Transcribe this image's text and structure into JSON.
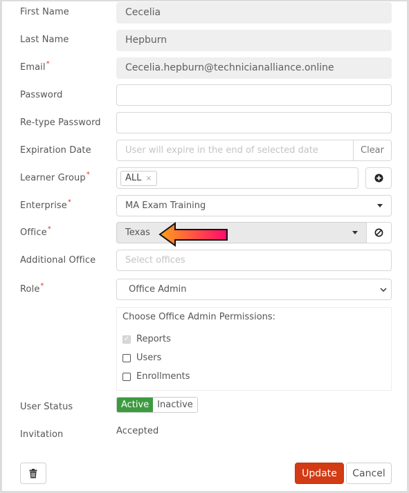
{
  "fields": {
    "first_name": {
      "label": "First Name",
      "value": "Cecelia"
    },
    "last_name": {
      "label": "Last Name",
      "value": "Hepburn"
    },
    "email": {
      "label": "Email",
      "required_mark": "*",
      "value": "Cecelia.hepburn@technicianalliance.online"
    },
    "password": {
      "label": "Password",
      "value": ""
    },
    "retype_password": {
      "label": "Re-type Password",
      "value": ""
    },
    "expiration_date": {
      "label": "Expiration Date",
      "placeholder": "User will expire in the end of selected date",
      "clear_label": "Clear"
    },
    "learner_group": {
      "label": "Learner Group",
      "required_mark": "*",
      "tags": [
        "ALL"
      ],
      "tag_remove": "×",
      "add_icon": "plus-circle-icon"
    },
    "enterprise": {
      "label": "Enterprise",
      "required_mark": "*",
      "value": "MA Exam Training"
    },
    "office": {
      "label": "Office",
      "required_mark": "*",
      "value": "Texas",
      "clear_icon": "ban-icon"
    },
    "additional_office": {
      "label": "Additional Office",
      "placeholder": "Select offices"
    },
    "role": {
      "label": "Role",
      "required_mark": "*",
      "value": "Office Admin"
    }
  },
  "permissions": {
    "title": "Choose Office Admin Permissions:",
    "items": [
      {
        "label": "Reports",
        "checked": true,
        "disabled": true
      },
      {
        "label": "Users",
        "checked": false,
        "disabled": false
      },
      {
        "label": "Enrollments",
        "checked": false,
        "disabled": false
      }
    ]
  },
  "user_status": {
    "label": "User Status",
    "options": [
      "Active",
      "Inactive"
    ],
    "selected": "Active"
  },
  "invitation": {
    "label": "Invitation",
    "value": "Accepted"
  },
  "actions": {
    "update_label": "Update",
    "cancel_label": "Cancel",
    "delete_icon": "trash-icon"
  },
  "colors": {
    "accent_update": "#d23b14",
    "active_status": "#3c9a3f",
    "required": "#e0322b",
    "arrow_start": "#ff9f1a",
    "arrow_end": "#ff0a6c"
  }
}
